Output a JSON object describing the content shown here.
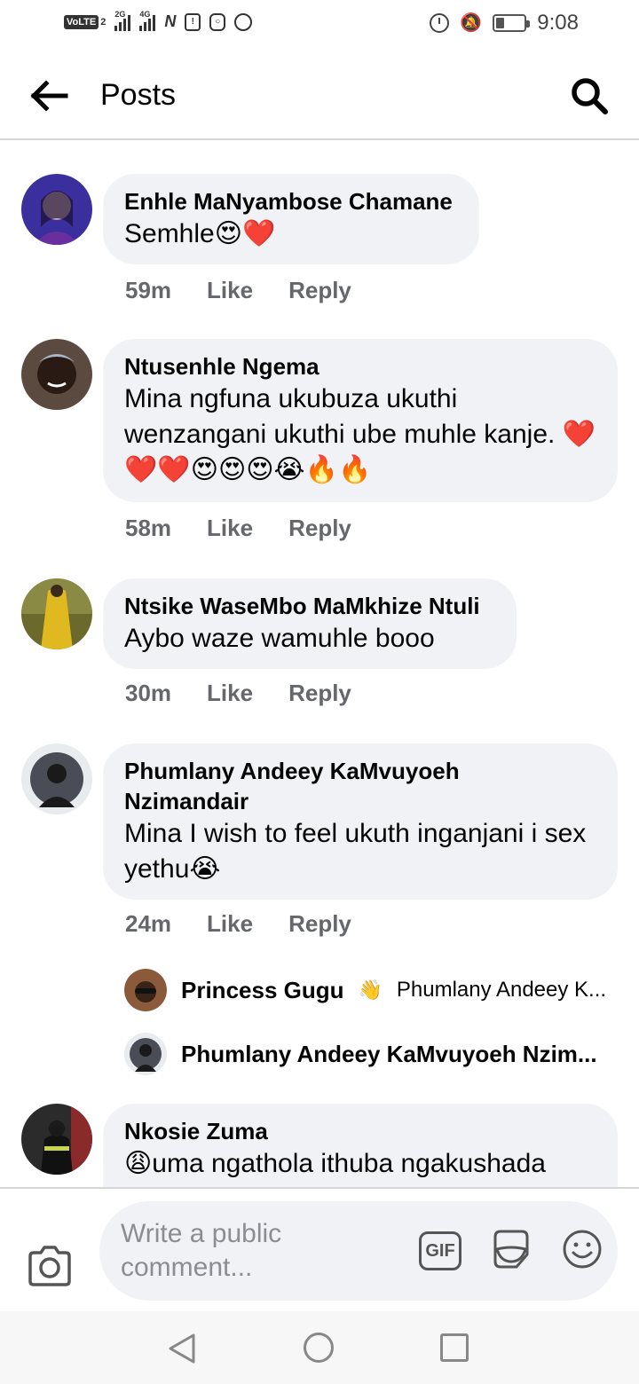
{
  "status_bar": {
    "volte": "VoLTE",
    "sim": "2",
    "net1": "2G",
    "net2": "4G",
    "time": "9:08",
    "battery_level": 0.3
  },
  "header": {
    "title": "Posts"
  },
  "comments": [
    {
      "name": "Enhle MaNyambose Chamane",
      "text": "Semhle😍❤️",
      "time": "59m",
      "like": "Like",
      "reply": "Reply",
      "avatar_color": "#3b2f9e"
    },
    {
      "name": "Ntusenhle Ngema",
      "text": "Mina ngfuna ukubuza ukuthi wenzangani ukuthi ube muhle kanje. ❤️❤️❤️😍😍😍😭🔥🔥",
      "time": "58m",
      "like": "Like",
      "reply": "Reply",
      "avatar_color": "#3a2a22"
    },
    {
      "name": "Ntsike WaseMbo MaMkhize Ntuli",
      "text": "Aybo waze wamuhle booo",
      "time": "30m",
      "like": "Like",
      "reply": "Reply",
      "avatar_color": "#6b6a2c"
    },
    {
      "name": "Phumlany Andeey KaMvuyoeh Nzimandair",
      "text": "Mina I wish to feel ukuth inganjani i sex yethu😭",
      "time": "24m",
      "like": "Like",
      "reply": "Reply",
      "avatar_color": "#4a4d55"
    },
    {
      "name": "Nkosie Zuma",
      "text": "😩uma ngathola ithuba ngakushada",
      "avatar_color": "#2b2b2b"
    }
  ],
  "replies": [
    {
      "name": "Princess Gugu",
      "icon": "👋",
      "snippet": "Phumlany Andeey K...",
      "avatar_color": "#8a5a3a"
    },
    {
      "name": "Phumlany Andeey KaMvuyoeh Nzim...",
      "avatar_color": "#4a4d55"
    }
  ],
  "composer": {
    "placeholder": "Write a public comment...",
    "gif_label": "GIF"
  },
  "colors": {
    "bubble": "#f0f2f5",
    "meta": "#65676b",
    "divider": "#d6d6d6"
  }
}
